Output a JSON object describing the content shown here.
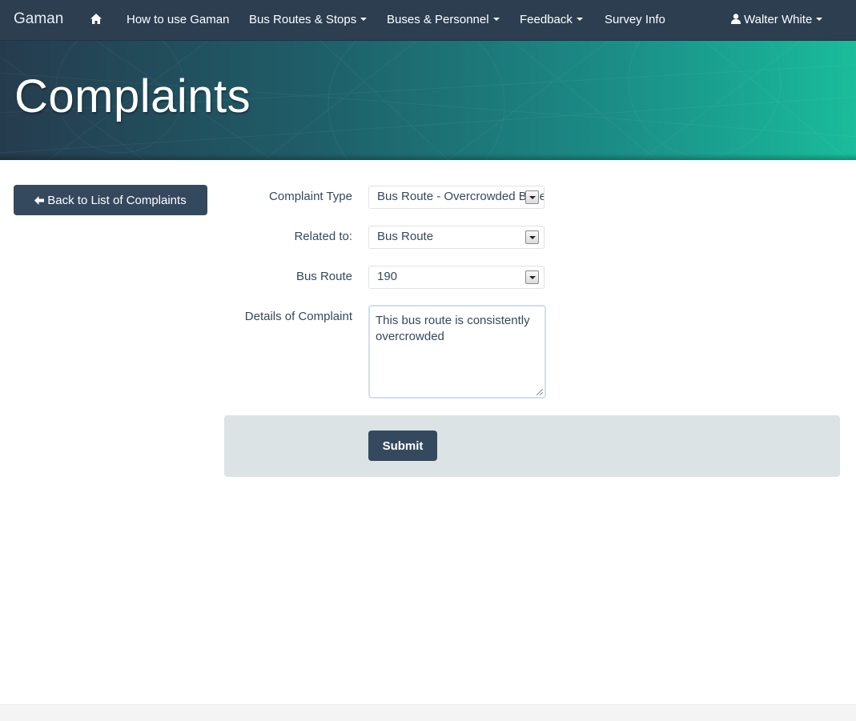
{
  "navbar": {
    "brand": "Gaman",
    "home_icon": "home-icon",
    "items": [
      {
        "label": "How to use Gaman",
        "dropdown": false
      },
      {
        "label": "Bus Routes & Stops",
        "dropdown": true
      },
      {
        "label": "Buses & Personnel",
        "dropdown": true
      },
      {
        "label": "Feedback",
        "dropdown": true
      },
      {
        "label": "Survey Info",
        "dropdown": false
      }
    ],
    "user": {
      "name": "Walter White",
      "icon": "user-icon",
      "dropdown": true
    }
  },
  "banner": {
    "title": "Complaints"
  },
  "back_button": {
    "label": "Back to List of Complaints",
    "icon": "arrow-left-icon"
  },
  "form": {
    "complaint_type": {
      "label": "Complaint Type",
      "value": "Bus Route - Overcrowded Buses"
    },
    "related_to": {
      "label": "Related to:",
      "value": "Bus Route"
    },
    "bus_route": {
      "label": "Bus Route",
      "value": "190"
    },
    "details": {
      "label": "Details of Complaint",
      "value": "This bus route is consistently overcrowded"
    },
    "submit_label": "Submit"
  },
  "colors": {
    "navbar": "#2c3e50",
    "button": "#34495e",
    "accent": "#1abc9c",
    "form_actions_bg": "#dce3e5"
  }
}
